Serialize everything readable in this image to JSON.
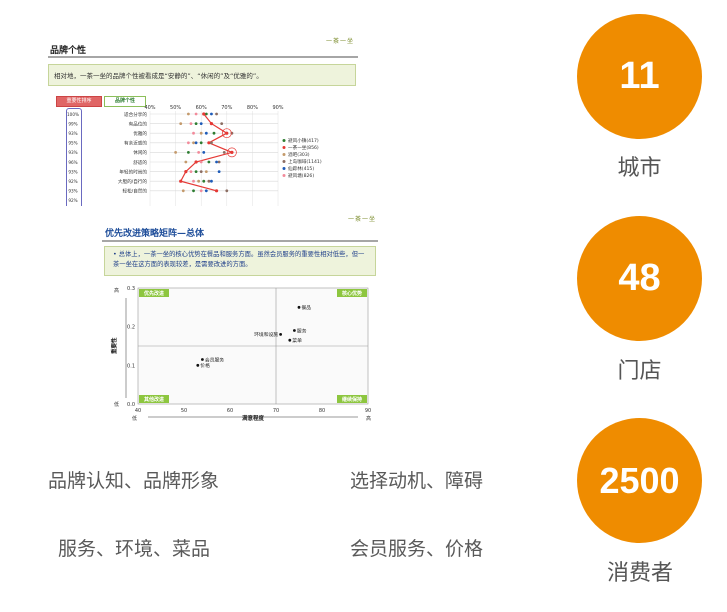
{
  "slide1": {
    "title": "品牌个性",
    "logo": "一茶一坐",
    "summary": "相对地，一茶一坐的品牌个性被看成是“安静的”、“休闲的”及“优雅的”。",
    "legend_head_a": "重要性排序",
    "legend_head_b": "品牌个性"
  },
  "slide2": {
    "title": "优先改进策略矩阵—总体",
    "logo": "一茶一坐",
    "summary": "• 总体上，一茶一坐的核心优势在餐品和服务方面。虽然会员服务的重要性相对低些，但一茶一坐在这方面的表现较差，是需要改进的方面。"
  },
  "chart_data": [
    {
      "type": "line",
      "title": "品牌个性",
      "x_ticks": [
        "40%",
        "50%",
        "60%",
        "70%",
        "80%",
        "90%"
      ],
      "xlim": [
        40,
        90
      ],
      "rank_labels": [
        "100%",
        "99%",
        "93%",
        "95%",
        "93%",
        "96%",
        "93%",
        "92%",
        "93%",
        "92%"
      ],
      "categories": [
        "适合分享的",
        "有品位的",
        "优雅的",
        "有亲近感的",
        "休闲的",
        "舒适的",
        "年轻的时尚的",
        "大胆的/自行的",
        "轻松/自然的"
      ],
      "series": [
        {
          "name": "避风小镇(417)",
          "color": "#2e7d32",
          "values": [
            62,
            58,
            65,
            60,
            55,
            63,
            58,
            61,
            57
          ]
        },
        {
          "name": "一茶一坐(856)",
          "color": "#e53935",
          "values": [
            61,
            64,
            70,
            63,
            72,
            58,
            54,
            52,
            66
          ]
        },
        {
          "name": "酒吧(303)",
          "color": "#c49a6c",
          "values": [
            55,
            52,
            60,
            57,
            50,
            54,
            62,
            59,
            53
          ]
        },
        {
          "name": "上岛咖啡(1141)",
          "color": "#8d6e63",
          "values": [
            66,
            68,
            72,
            64,
            69,
            67,
            60,
            63,
            70
          ]
        },
        {
          "name": "仙踪林(415)",
          "color": "#1e5bb8",
          "values": [
            64,
            60,
            62,
            58,
            61,
            66,
            67,
            64,
            62
          ]
        },
        {
          "name": "避风塘(826)",
          "color": "#f28b9b",
          "values": [
            58,
            56,
            57,
            55,
            59,
            60,
            56,
            57,
            60
          ]
        }
      ]
    },
    {
      "type": "scatter",
      "title": "优先改进策略矩阵—总体",
      "xlabel": "满意程度",
      "ylabel": "重要性",
      "xlim": [
        40,
        90
      ],
      "ylim": [
        0.0,
        0.3
      ],
      "x_ticks": [
        "40",
        "50",
        "60",
        "70",
        "80",
        "90"
      ],
      "y_ticks": [
        "0.0",
        "0.1",
        "0.2",
        "0.3"
      ],
      "x_low": "低",
      "x_high": "高",
      "y_low": "低",
      "y_high": "高",
      "quadrants": {
        "top_left": "优先改进",
        "top_right": "核心优势",
        "bottom_left": "其他改进",
        "bottom_right": "继续保持"
      },
      "points": [
        {
          "label": "餐品",
          "x": 75,
          "y": 0.25
        },
        {
          "label": "服务",
          "x": 74,
          "y": 0.19
        },
        {
          "label": "环境和设施",
          "x": 71,
          "y": 0.18
        },
        {
          "label": "菜单",
          "x": 73,
          "y": 0.165
        },
        {
          "label": "会员服务",
          "x": 54,
          "y": 0.115
        },
        {
          "label": "价格",
          "x": 53,
          "y": 0.1
        }
      ]
    }
  ],
  "stats": [
    {
      "value": "11",
      "label": "城市"
    },
    {
      "value": "48",
      "label": "门店"
    },
    {
      "value": "2500",
      "label": "消费者"
    }
  ],
  "topics": [
    "品牌认知、品牌形象",
    "选择动机、障碍",
    "服务、环境、菜品",
    "会员服务、价格"
  ],
  "colors": {
    "accent": "#ef8c00",
    "summary_bg": "#eef3dc",
    "quadrant_green": "#8dc63f"
  }
}
